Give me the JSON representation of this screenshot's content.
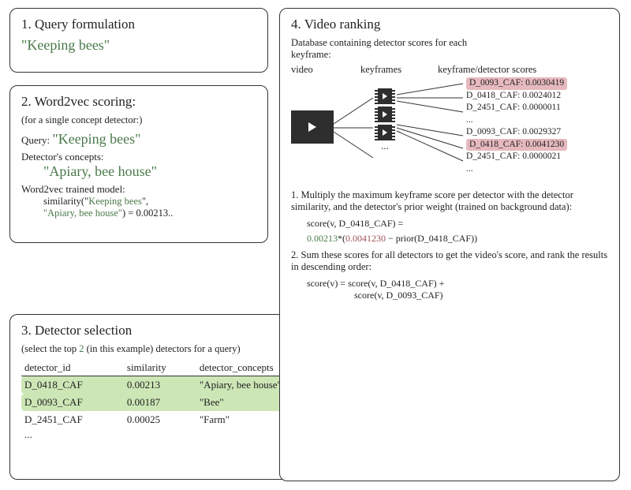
{
  "panel1": {
    "title": "1. Query formulation",
    "query": "\"Keeping bees\""
  },
  "panel2": {
    "title": "2. Word2vec scoring:",
    "subtitle": "(for a single concept detector:)",
    "query_label": "Query:",
    "query": "\"Keeping bees\"",
    "dc_label": "Detector's concepts:",
    "dc": "\"Apiary, bee house\"",
    "model_label": "Word2vec trained model:",
    "sim_text1": "similarity(\"",
    "sim_q": "Keeping bees",
    "sim_mid": "\",",
    "sim_c": "\"Apiary, bee house\"",
    "sim_text2": ") = 0.00213.."
  },
  "panel3": {
    "title": "3. Detector selection",
    "subtitle_a": "(select the top ",
    "topn": "2",
    "subtitle_b": " (in this example) detectors for a query)",
    "cols": {
      "c1": "detector_id",
      "c2": "similarity",
      "c3": "detector_concepts"
    },
    "rows": [
      {
        "id": "D_0418_CAF",
        "sim": "0.00213",
        "c": "\"Apiary, bee house\"",
        "hl": true
      },
      {
        "id": "D_0093_CAF",
        "sim": "0.00187",
        "c": "\"Bee\"",
        "hl": true
      },
      {
        "id": "D_2451_CAF",
        "sim": "0.00025",
        "c": "\"Farm\"",
        "hl": false
      }
    ],
    "ellipsis": "..."
  },
  "panel4": {
    "title": "4. Video ranking",
    "db_label": "Database containing detector scores for each keyframe:",
    "cols": {
      "c1": "video",
      "c2": "keyframes",
      "c3": "keyframe/detector scores"
    },
    "group1": [
      {
        "t": "D_0093_CAF:  0.0030419",
        "hl": true
      },
      {
        "t": "D_0418_CAF:  0.0024012",
        "hl": false
      },
      {
        "t": "D_2451_CAF:  0.0000011",
        "hl": false
      },
      {
        "t": "...",
        "hl": false
      }
    ],
    "group2": [
      {
        "t": "D_0093_CAF: 0.0029327",
        "hl": false
      },
      {
        "t": "D_0418_CAF: 0.0041230",
        "hl": true
      },
      {
        "t": "D_2451_CAF: 0.0000021",
        "hl": false
      },
      {
        "t": "...",
        "hl": false
      }
    ],
    "step1": "1. Multiply the maximum keyframe score per detector with the detector similarity, and  the detector's prior weight (trained on background data):",
    "eq1a": "score(v, D_0418_CAF) =",
    "eq1b_g": "0.00213",
    "eq1b_star": "*(",
    "eq1b_r": "0.0041230",
    "eq1b_tail": " − prior(D_0418_CAF))",
    "step2": "2. Sum these scores for all detectors to get the video's score, and rank the results in descending order:",
    "eq2a": "score(v) = score(v, D_0418_CAF) +",
    "eq2b": "score(v, D_0093_CAF)"
  }
}
